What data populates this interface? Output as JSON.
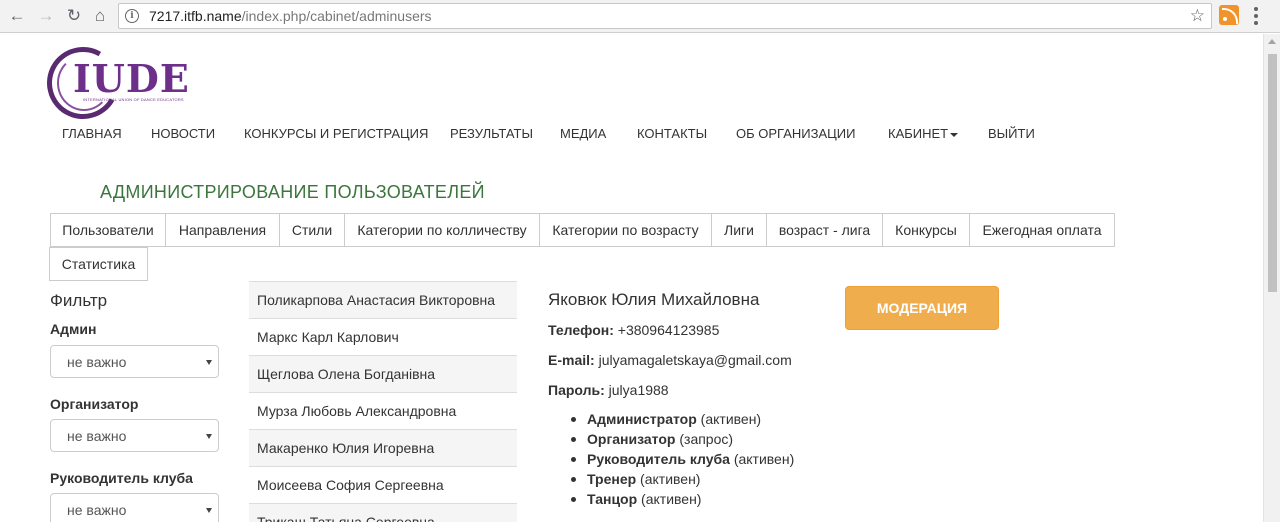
{
  "browser": {
    "url_host": "7217.itfb.name",
    "url_path": "/index.php/cabinet/adminusers"
  },
  "logo": {
    "text": "IUDE",
    "subtitle": "INTERNATIONAL UNION OF DANCE EDUCATORS"
  },
  "nav": {
    "items": [
      "ГЛАВНАЯ",
      "НОВОСТИ",
      "КОНКУРСЫ И РЕГИСТРАЦИЯ",
      "РЕЗУЛЬТАТЫ",
      "МЕДИА",
      "КОНТАКТЫ",
      "ОБ ОРГАНИЗАЦИИ",
      "КАБИНЕТ",
      "ВЫЙТИ"
    ]
  },
  "page_title": "АДМИНИСТРИРОВАНИЕ ПОЛЬЗОВАТЕЛЕЙ",
  "tabs": [
    "Пользователи",
    "Направления",
    "Стили",
    "Категории по колличеству",
    "Категории по возрасту",
    "Лиги",
    "возраст - лига",
    "Конкурсы",
    "Ежегодная оплата",
    "Статистика"
  ],
  "filter": {
    "title": "Фильтр",
    "fields": [
      {
        "label": "Админ",
        "value": "не важно"
      },
      {
        "label": "Организатор",
        "value": "не важно"
      },
      {
        "label": "Руководитель клуба",
        "value": "не важно"
      }
    ]
  },
  "users": [
    "Поликарпова Анастасия Викторовна",
    "Маркс Карл Карлович",
    "Щеглова Олена Богданівна",
    "Мурза Любовь Александровна",
    "Макаренко Юлия Игоревна",
    "Моисеева София Сергеевна",
    "Трикаш Татьяна Сергеевна"
  ],
  "selected_user": {
    "name": "Яковюк Юлия Михайловна",
    "phone_label": "Телефон:",
    "phone": "+380964123985",
    "email_label": "E-mail:",
    "email": "julyamagaletskaya@gmail.com",
    "password_label": "Пароль:",
    "password": "julya1988",
    "roles": [
      {
        "role": "Администратор",
        "status": "(активен)"
      },
      {
        "role": "Организатор",
        "status": "(запрос)"
      },
      {
        "role": "Руководитель клуба",
        "status": "(активен)"
      },
      {
        "role": "Тренер",
        "status": "(активен)"
      },
      {
        "role": "Танцор",
        "status": "(активен)"
      }
    ]
  },
  "moderation_button": "МОДЕРАЦИЯ",
  "colors": {
    "title_green": "#3c763d",
    "moderation_orange": "#f0ad4e",
    "logo_purple": "#6e2f8a"
  }
}
